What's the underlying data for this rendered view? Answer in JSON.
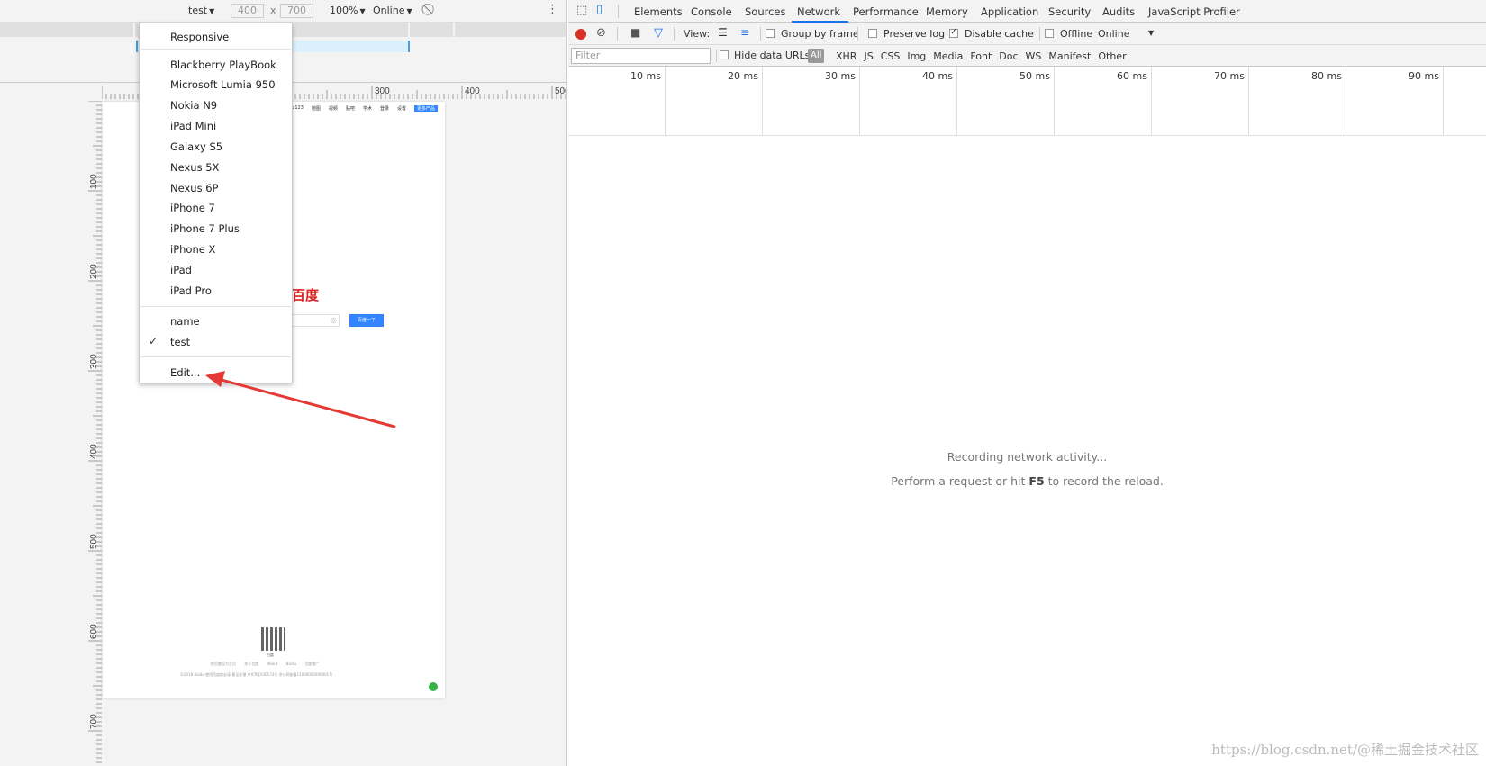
{
  "device_toolbar": {
    "device": "test",
    "width": "400",
    "times": "x",
    "height": "700",
    "zoom": "100%",
    "network": "Online"
  },
  "ruler_top_labels": [
    "300",
    "400",
    "500"
  ],
  "ruler_left_labels": [
    "100",
    "200",
    "300",
    "400",
    "500",
    "600",
    "700"
  ],
  "device_menu": {
    "items_top": [
      "Responsive"
    ],
    "items_devices": [
      "Blackberry PlayBook",
      "Microsoft Lumia 950",
      "Nokia N9",
      "iPad Mini",
      "Galaxy S5",
      "Nexus 5X",
      "Nexus 6P",
      "iPhone 7",
      "iPhone 7 Plus",
      "iPhone X",
      "iPad",
      "iPad Pro"
    ],
    "items_custom": [
      "name",
      "test"
    ],
    "selected": "test",
    "edit": "Edit..."
  },
  "emulated_page": {
    "nav": [
      "hao123",
      "地图",
      "视频",
      "贴吧",
      "学术",
      "登录",
      "设置"
    ],
    "nav_button": "更多产品",
    "logo_fragment": "百度",
    "search_button": "百度一下",
    "qr_label": "百度",
    "footer1": "把百度设为主页 关于百度 About Baidu 百度推广",
    "footer2": "©2018 Baidu 使用百度前必读 意见反馈 京ICP证030173号 京公网安备11000002000001号"
  },
  "devtools": {
    "tabs": [
      "Elements",
      "Console",
      "Sources",
      "Network",
      "Performance",
      "Memory",
      "Application",
      "Security",
      "Audits",
      "JavaScript Profiler"
    ],
    "active_tab": "Network",
    "toolbar": {
      "view": "View:",
      "group_by_frame": "Group by frame",
      "preserve_log": "Preserve log",
      "disable_cache": "Disable cache",
      "offline": "Offline",
      "online": "Online"
    },
    "filter": {
      "placeholder": "Filter",
      "hide_data_urls": "Hide data URLs",
      "all": "All",
      "types": [
        "XHR",
        "JS",
        "CSS",
        "Img",
        "Media",
        "Font",
        "Doc",
        "WS",
        "Manifest",
        "Other"
      ]
    },
    "timeline_labels": [
      "10 ms",
      "20 ms",
      "30 ms",
      "40 ms",
      "50 ms",
      "60 ms",
      "70 ms",
      "80 ms",
      "90 ms"
    ],
    "empty_line1": "Recording network activity...",
    "empty_line2_pre": "Perform a request or hit ",
    "empty_line2_key": "F5",
    "empty_line2_post": " to record the reload."
  },
  "watermark": "https://blog.csdn.net/@稀土掘金技术社区",
  "colors": {
    "record": "#d93025",
    "accent": "#1a73e8",
    "arrow": "#e53935"
  }
}
